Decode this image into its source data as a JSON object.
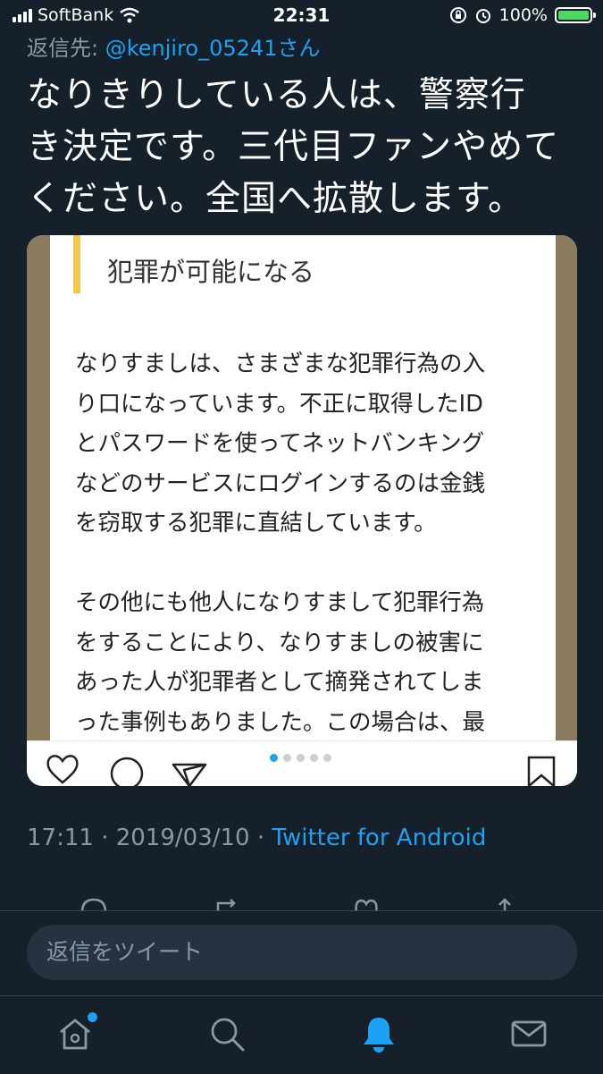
{
  "status_bar": {
    "carrier": "SoftBank",
    "time": "22:31",
    "battery": "100%",
    "battery_color": "#4cd964"
  },
  "reply_to": {
    "prefix": "返信先:",
    "handle": "@kenjiro_05241さん"
  },
  "tweet": {
    "lines": [
      "なりきりしている人は、警察行",
      "き決定です。三代目ファンやめて",
      "ください。全国へ拡散します。"
    ]
  },
  "media": {
    "heading": "犯罪が可能になる",
    "paragraph1": [
      "なりすましは、さまざまな犯罪行為の入",
      "り口になっています。不正に取得したID",
      "とパスワードを使ってネットバンキング",
      "などのサービスにログインするのは金銭",
      "を窃取する犯罪に直結しています。"
    ],
    "paragraph2": [
      "その他にも他人になりすまして犯罪行為",
      "をすることにより、なりすましの被害に",
      "あった人が犯罪者として摘発されてしま",
      "った事例もありました。この場合は、最"
    ],
    "page_count": 5,
    "current_page": 1,
    "action_icons": [
      "heart-icon",
      "comment-icon",
      "send-icon",
      "bookmark-icon"
    ]
  },
  "meta": {
    "timestamp": "17:11 · 2019/03/10 ·",
    "client": "Twitter for Android"
  },
  "reply_bar": {
    "placeholder": "返信をツイート"
  },
  "tab_bar": {
    "items": [
      "home-icon",
      "search-icon",
      "notifications-icon",
      "messages-icon"
    ],
    "active": "notifications-icon",
    "accent_color": "#1da1f2"
  }
}
